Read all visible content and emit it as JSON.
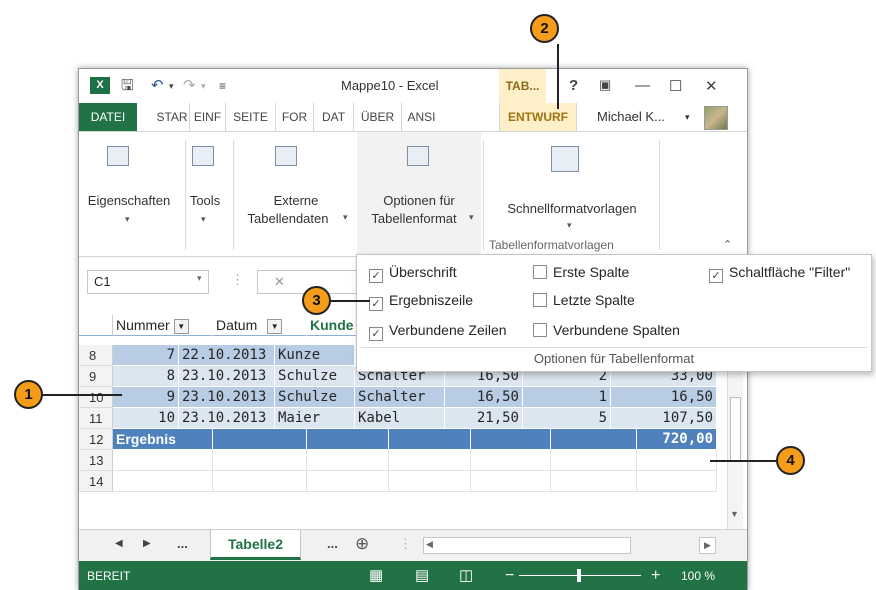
{
  "titlebar": {
    "title": "Mappe10 - Excel",
    "context_tab": "TAB...",
    "help": "?",
    "logo": "X"
  },
  "ribbon_tabs": [
    "DATEI",
    "STAR",
    "EINF",
    "SEITE",
    "FOR",
    "DAT",
    "ÜBER",
    "ANSI",
    "ENTWURF"
  ],
  "user_name": "Michael K...",
  "ribbon": {
    "eigenschaften": "Eigenschaften",
    "tools": "Tools",
    "externe_1": "Externe",
    "externe_2": "Tabellendaten",
    "optionen_1": "Optionen für",
    "optionen_2": "Tabellenformat",
    "schnell": "Schnellformatvorlagen",
    "group_label": "Tabellenformatvorlagen"
  },
  "namebox": "C1",
  "headers": [
    "Nummer",
    "Datum",
    "Kunde"
  ],
  "rows": [
    {
      "n": "8",
      "nr": "7",
      "datum": "22.10.2013",
      "kunde": "Kunze",
      "art": "",
      "preis": "",
      "menge": "",
      "summe": ""
    },
    {
      "n": "9",
      "nr": "8",
      "datum": "23.10.2013",
      "kunde": "Schulze",
      "art": "Schalter",
      "preis": "16,50",
      "menge": "2",
      "summe": "33,00"
    },
    {
      "n": "10",
      "nr": "9",
      "datum": "23.10.2013",
      "kunde": "Schulze",
      "art": "Schalter",
      "preis": "16,50",
      "menge": "1",
      "summe": "16,50"
    },
    {
      "n": "11",
      "nr": "10",
      "datum": "23.10.2013",
      "kunde": "Maier",
      "art": "Kabel",
      "preis": "21,50",
      "menge": "5",
      "summe": "107,50"
    }
  ],
  "total_row": {
    "n": "12",
    "label": "Ergebnis",
    "summe": "720,00"
  },
  "empty_rows": [
    "13",
    "14"
  ],
  "sheet_tab": "Tabelle2",
  "sheet_dots": "...",
  "status": {
    "ready": "BEREIT",
    "zoom": "100 %"
  },
  "options": {
    "ueberschrift": "Überschrift",
    "ergebniszeile": "Ergebniszeile",
    "verb_zeilen": "Verbundene Zeilen",
    "erste_spalte": "Erste Spalte",
    "letzte_spalte": "Letzte Spalte",
    "verb_spalten": "Verbundene Spalten",
    "filter": "Schaltfläche \"Filter\"",
    "title": "Optionen für Tabellenformat"
  },
  "callouts": [
    "1",
    "2",
    "3",
    "4"
  ],
  "colors": {
    "excel_green": "#217346",
    "callout": "#f59c1a",
    "table_dark": "#4f81bd",
    "band": "#b8cce4"
  }
}
